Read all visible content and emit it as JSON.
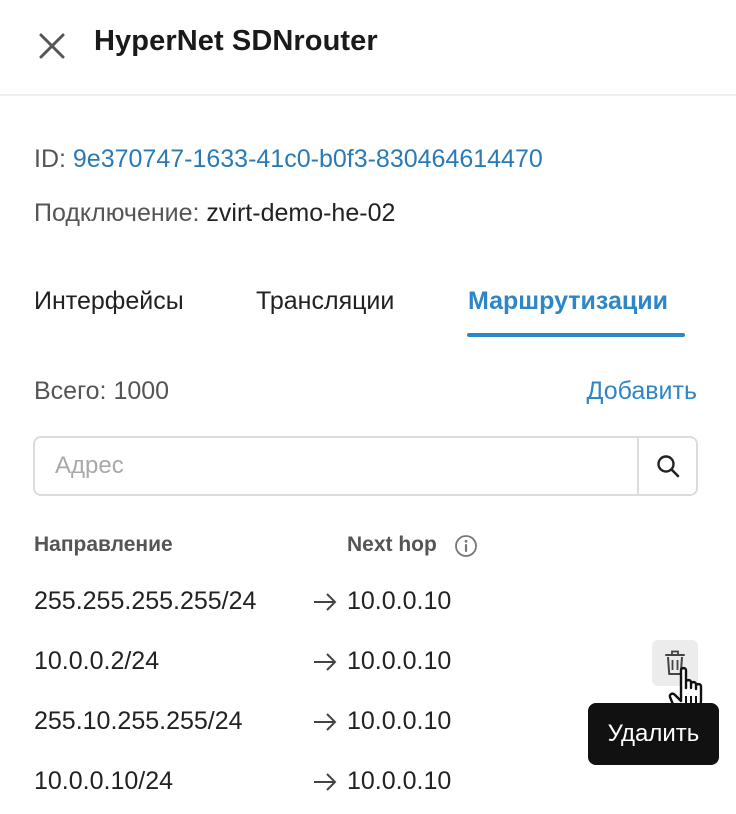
{
  "header": {
    "title": "HyperNet SDNrouter",
    "close_icon": "close-icon"
  },
  "meta": {
    "id_label": "ID:",
    "id_value": "9e370747-1633-41c0-b0f3-830464614470",
    "connection_label": "Подключение:",
    "connection_value": "zvirt-demo-he-02"
  },
  "tabs": [
    {
      "label": "Интерфейсы",
      "active": false
    },
    {
      "label": "Трансляции",
      "active": false
    },
    {
      "label": "Маршрутизации",
      "active": true
    }
  ],
  "toolbar": {
    "total_label": "Всего: 1000",
    "add_label": "Добавить"
  },
  "search": {
    "placeholder": "Адрес",
    "value": "",
    "icon": "search-icon"
  },
  "table": {
    "columns": [
      "Направление",
      "Next hop"
    ],
    "next_hop_info_icon": "info-icon",
    "rows": [
      {
        "destination": "255.255.255.255/24",
        "next_hop": "10.0.0.10"
      },
      {
        "destination": "10.0.0.2/24",
        "next_hop": "10.0.0.10"
      },
      {
        "destination": "255.10.255.255/24",
        "next_hop": "10.0.0.10"
      },
      {
        "destination": "10.0.0.10/24",
        "next_hop": "10.0.0.10"
      }
    ]
  },
  "row_action": {
    "icon": "trash-icon",
    "tooltip": "Удалить"
  },
  "colors": {
    "accent": "#2f86c6",
    "id_link": "#2a7ab6",
    "tooltip_bg": "#111111"
  }
}
